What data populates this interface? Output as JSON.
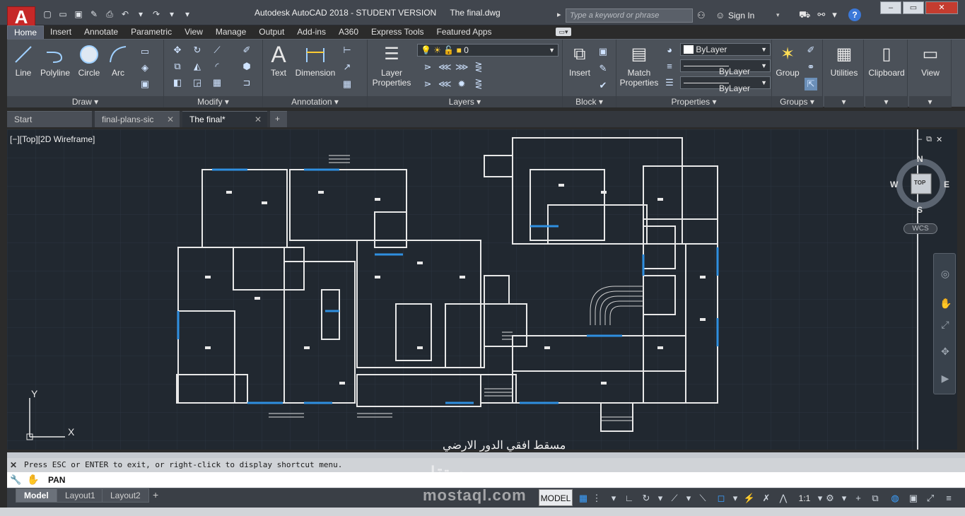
{
  "window": {
    "app_title": "Autodesk AutoCAD 2018 - STUDENT VERSION",
    "file_title": "The final.dwg",
    "search_placeholder": "Type a keyword or phrase",
    "sign_in": "Sign In",
    "logo_letter": "A",
    "minimize": "–",
    "restore": "▭",
    "close": "✕"
  },
  "ribbon_tabs": [
    "Home",
    "Insert",
    "Annotate",
    "Parametric",
    "View",
    "Manage",
    "Output",
    "Add-ins",
    "A360",
    "Express Tools",
    "Featured Apps"
  ],
  "ribbon": {
    "draw": {
      "label": "Draw",
      "line": "Line",
      "polyline": "Polyline",
      "circle": "Circle",
      "arc": "Arc"
    },
    "modify": {
      "label": "Modify"
    },
    "annotation": {
      "label": "Annotation",
      "text": "Text",
      "dimension": "Dimension"
    },
    "layers": {
      "label": "Layers",
      "layer_properties_1": "Layer",
      "layer_properties_2": "Properties",
      "current_layer": "0"
    },
    "block": {
      "label": "Block",
      "insert": "Insert"
    },
    "properties": {
      "label": "Properties",
      "match_1": "Match",
      "match_2": "Properties",
      "color": "ByLayer",
      "linetype": "ByLayer",
      "lineweight": "ByLayer"
    },
    "groups": {
      "label": "Groups",
      "group": "Group"
    },
    "utilities": "Utilities",
    "clipboard": "Clipboard",
    "view": "View"
  },
  "doc_tabs": [
    {
      "label": "Start"
    },
    {
      "label": "final-plans-sic"
    },
    {
      "label": "The final*"
    }
  ],
  "viewport": {
    "label": "[−][Top][2D Wireframe]",
    "viewcube": {
      "top": "TOP",
      "n": "N",
      "s": "S",
      "e": "E",
      "w": "W"
    },
    "wcs": "WCS",
    "plan_title": "مسقط افقي الدور الارضي",
    "ucs_y": "Y",
    "ucs_x": "X"
  },
  "command": {
    "history": "Press ESC or ENTER to exit, or right-click to display shortcut menu.",
    "current": "PAN"
  },
  "layout_tabs": [
    "Model",
    "Layout1",
    "Layout2"
  ],
  "status": {
    "model": "MODEL",
    "scale": "1:1"
  },
  "watermark": "mostaql.com",
  "colors": {
    "accent": "#3aa0ff",
    "canvas": "#212830",
    "ribbon": "#4b5159",
    "plan_lines": "#e8e8e8",
    "windows": "#2f8fe0"
  }
}
